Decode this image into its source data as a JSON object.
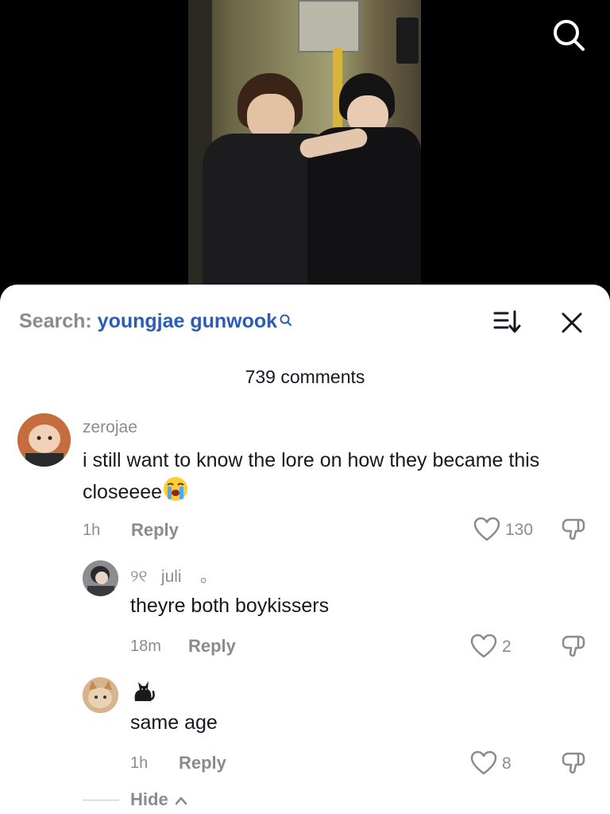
{
  "video": {
    "search_icon": "search-icon"
  },
  "header": {
    "search_prefix": "Search:",
    "search_query": "youngjae gunwook",
    "sort_icon": "sort-icon",
    "close_icon": "close-icon"
  },
  "comments_count": "739 comments",
  "comments": [
    {
      "username": "zerojae",
      "text": "i still want to know the lore on how they became this closeeee",
      "emoji": "loudly-crying-face-emoji",
      "time": "1h",
      "reply_label": "Reply",
      "likes": "130"
    }
  ],
  "replies": [
    {
      "username_prefix": "୨୧",
      "username": "juli",
      "username_suffix": "。",
      "text": "theyre both boykissers",
      "time": "18m",
      "reply_label": "Reply",
      "likes": "2"
    },
    {
      "username_icon": "black-cat-emoji",
      "text": "same age",
      "time": "1h",
      "reply_label": "Reply",
      "likes": "8"
    }
  ],
  "hide_label": "Hide"
}
